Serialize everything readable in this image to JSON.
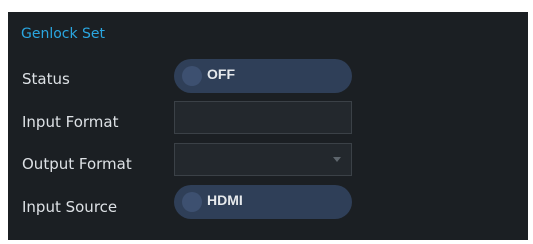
{
  "panel": {
    "title": "Genlock Set",
    "title_color": "#2aa6e0",
    "background": "#1b1f23"
  },
  "status": {
    "label": "Status",
    "value": "OFF"
  },
  "input_format": {
    "label": "Input Format",
    "value": ""
  },
  "output_format": {
    "label": "Output Format",
    "selected": "",
    "icon": "chevron-down-icon"
  },
  "input_source": {
    "label": "Input Source",
    "value": "HDMI"
  }
}
